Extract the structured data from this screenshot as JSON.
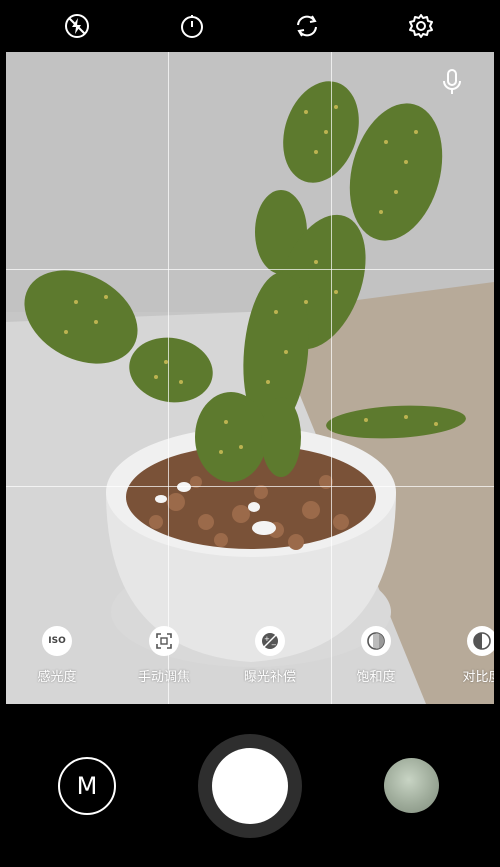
{
  "top_bar": {
    "icons": [
      "flash-off-icon",
      "timer-icon",
      "switch-camera-icon",
      "settings-icon"
    ]
  },
  "viewfinder": {
    "grid": "3x3",
    "mic_icon": "microphone-icon"
  },
  "modes": [
    {
      "label": "感光度",
      "icon": "iso-icon",
      "badge": "ISO"
    },
    {
      "label": "手动调焦",
      "icon": "manual-focus-icon"
    },
    {
      "label": "曝光补偿",
      "icon": "exposure-compensation-icon"
    },
    {
      "label": "饱和度",
      "icon": "saturation-icon"
    },
    {
      "label": "对比度",
      "icon": "contrast-icon"
    }
  ],
  "bottom_bar": {
    "mode_button_label": "M",
    "shutter": "shutter-button",
    "gallery": "gallery-thumbnail"
  }
}
